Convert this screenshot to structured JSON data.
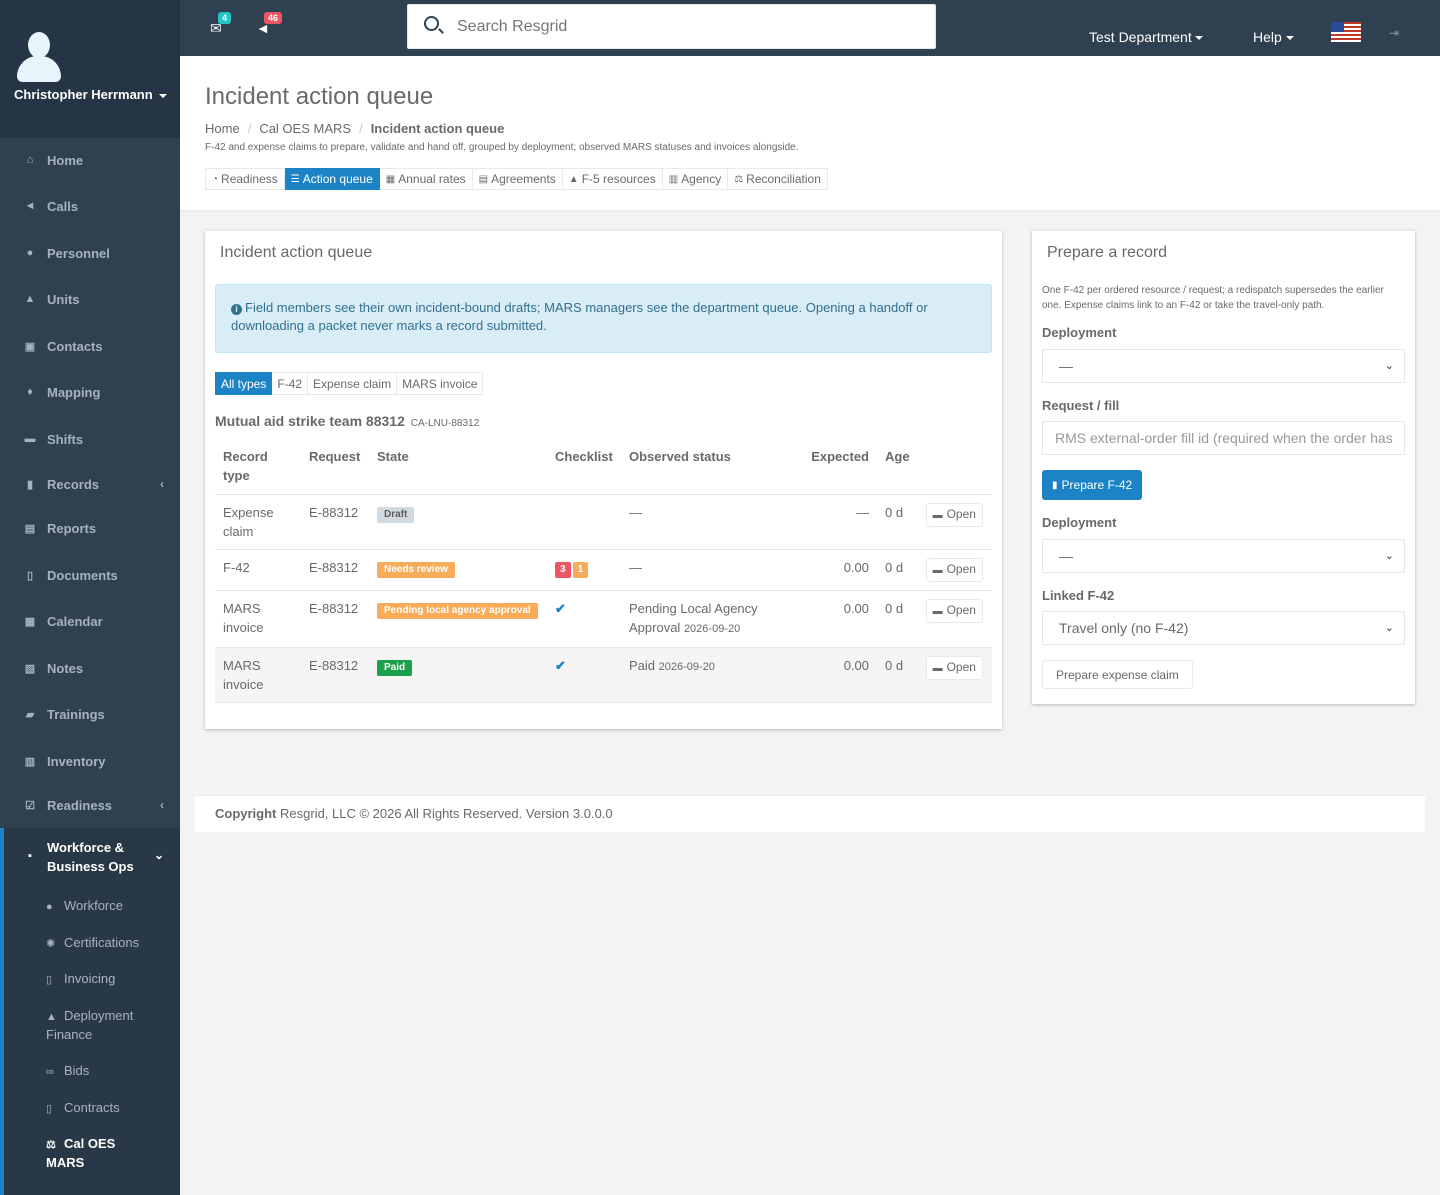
{
  "sidebar": {
    "user_name": "Christopher Herrmann",
    "items": [
      {
        "label": "Home",
        "icon": "home-icon"
      },
      {
        "label": "Calls",
        "icon": "bullhorn-icon"
      },
      {
        "label": "Personnel",
        "icon": "user-icon"
      },
      {
        "label": "Units",
        "icon": "truck-icon"
      },
      {
        "label": "Contacts",
        "icon": "contact-card-icon"
      },
      {
        "label": "Mapping",
        "icon": "map-marker-icon"
      },
      {
        "label": "Shifts",
        "icon": "shifts-icon"
      },
      {
        "label": "Records",
        "icon": "file-icon"
      },
      {
        "label": "Reports",
        "icon": "reports-icon"
      },
      {
        "label": "Documents",
        "icon": "document-icon"
      },
      {
        "label": "Calendar",
        "icon": "calendar-icon"
      },
      {
        "label": "Notes",
        "icon": "notes-icon"
      },
      {
        "label": "Trainings",
        "icon": "book-icon"
      },
      {
        "label": "Inventory",
        "icon": "barcode-icon"
      },
      {
        "label": "Readiness",
        "icon": "check-square-icon"
      }
    ],
    "active_group": {
      "label": "Workforce & Business Ops",
      "icon": "briefcase-icon"
    },
    "sub_items": [
      {
        "label": "Workforce",
        "icon": "users-icon"
      },
      {
        "label": "Certifications",
        "icon": "certificate-icon"
      },
      {
        "label": "Invoicing",
        "icon": "invoice-icon"
      },
      {
        "label": "Deployment Finance",
        "icon": "truck-icon"
      },
      {
        "label": "Bids",
        "icon": "handshake-icon"
      },
      {
        "label": "Contracts",
        "icon": "contract-icon"
      },
      {
        "label": "Cal OES MARS",
        "icon": "balance-scale-icon"
      }
    ]
  },
  "topbar": {
    "mail_count": "4",
    "alert_count": "46",
    "search_placeholder": "Search Resgrid",
    "department": "Test Department",
    "help": "Help"
  },
  "page": {
    "title": "Incident action queue",
    "breadcrumb": [
      "Home",
      "Cal OES MARS",
      "Incident action queue"
    ],
    "description": "F-42 and expense claims to prepare, validate and hand off, grouped by deployment; observed MARS statuses and invoices alongside.",
    "tabs": [
      {
        "label": "Readiness",
        "icon": "dashboard-icon",
        "active": false
      },
      {
        "label": "Action queue",
        "icon": "list-icon",
        "active": true
      },
      {
        "label": "Annual rates",
        "icon": "table-icon",
        "active": false
      },
      {
        "label": "Agreements",
        "icon": "agreement-icon",
        "active": false
      },
      {
        "label": "F-5 resources",
        "icon": "truck-icon",
        "active": false
      },
      {
        "label": "Agency",
        "icon": "building-icon",
        "active": false
      },
      {
        "label": "Reconciliation",
        "icon": "balance-scale-icon",
        "active": false
      }
    ]
  },
  "queue": {
    "title": "Incident action queue",
    "alert": "Field members see their own incident-bound drafts; MARS managers see the department queue. Opening a handoff or downloading a packet never marks a record submitted.",
    "filters": [
      "All types",
      "F-42",
      "Expense claim",
      "MARS invoice"
    ],
    "group_name": "Mutual aid strike team 88312",
    "group_code": "CA-LNU-88312",
    "columns": [
      "Record type",
      "Request",
      "State",
      "Checklist",
      "Observed status",
      "Expected",
      "Age"
    ],
    "open_label": "Open",
    "rows": [
      {
        "type": "Expense claim",
        "request": "E-88312",
        "state": "Draft",
        "state_style": "draft",
        "checklist_errors": "",
        "checklist_warnings": "",
        "checklist_ok": false,
        "observed": "—",
        "observed_date": "",
        "expected": "—",
        "age": "0 d"
      },
      {
        "type": "F-42",
        "request": "E-88312",
        "state": "Needs review",
        "state_style": "warn",
        "checklist_errors": "3",
        "checklist_warnings": "1",
        "checklist_ok": false,
        "observed": "—",
        "observed_date": "",
        "expected": "0.00",
        "age": "0 d"
      },
      {
        "type": "MARS invoice",
        "request": "E-88312",
        "state": "Pending local agency approval",
        "state_style": "warn",
        "checklist_errors": "",
        "checklist_warnings": "",
        "checklist_ok": true,
        "observed": "Pending Local Agency Approval",
        "observed_date": "2026-09-20",
        "expected": "0.00",
        "age": "0 d"
      },
      {
        "type": "MARS invoice",
        "request": "E-88312",
        "state": "Paid",
        "state_style": "ok",
        "checklist_errors": "",
        "checklist_warnings": "",
        "checklist_ok": true,
        "observed": "Paid",
        "observed_date": "2026-09-20",
        "expected": "0.00",
        "age": "0 d"
      }
    ]
  },
  "prepare": {
    "title": "Prepare a record",
    "help": "One F-42 per ordered resource / request; a redispatch supersedes the earlier one. Expense claims link to an F-42 or take the travel-only path.",
    "deployment_label": "Deployment",
    "deployment_value": "—",
    "request_label": "Request / fill",
    "request_placeholder": "RMS external-order fill id (required when the order has",
    "prepare_f42": "Prepare F-42",
    "deployment2_label": "Deployment",
    "deployment2_value": "—",
    "linked_label": "Linked F-42",
    "linked_value": "Travel only (no F-42)",
    "prepare_expense": "Prepare expense claim"
  },
  "footer": {
    "copyright": "Copyright",
    "text": "Resgrid, LLC © 2026 All Rights Reserved.",
    "version": "Version 3.0.0.0"
  },
  "colors": {
    "sidebar": "#2f4050",
    "accent": "#1c84c6",
    "warning": "#f8ac59",
    "danger": "#ed5565",
    "success": "#1c9f4c"
  }
}
